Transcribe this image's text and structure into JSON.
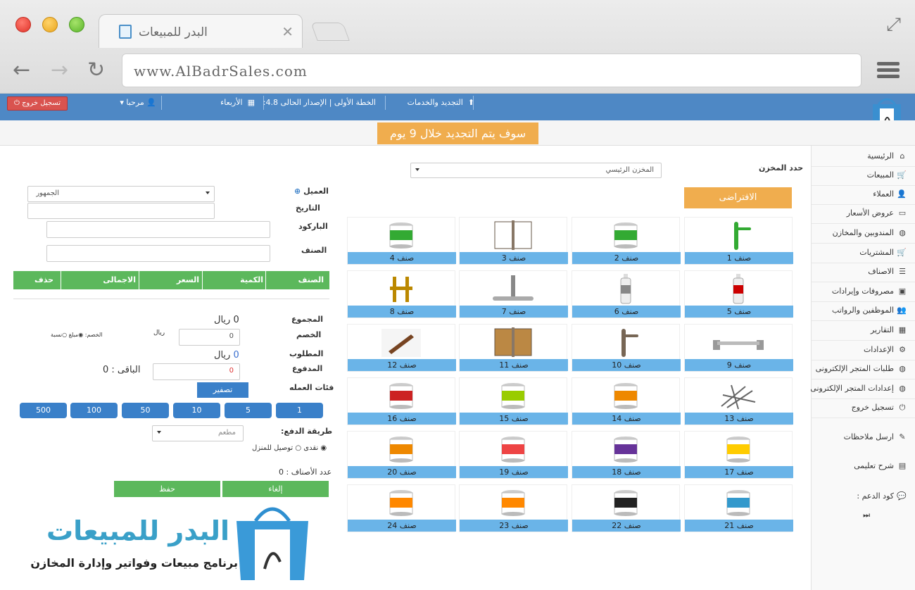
{
  "browser": {
    "tab_title": "البدر للمبيعات",
    "url": "www.AlBadrSales.com"
  },
  "topbar": {
    "updates": "التجديد والخدمات",
    "plan": "الخطة الأولى | الإصدار الحالى 4.8:",
    "day": "الأربعاء",
    "welcome": "مرحبا",
    "logout": "تسجيل خروج"
  },
  "notice": "سوف يتم التجديد خلال 9 يوم",
  "sidebar": {
    "items": [
      {
        "label": "الرئيسية",
        "icon": "home-icon"
      },
      {
        "label": "المبيعات",
        "icon": "cart-icon"
      },
      {
        "label": "العملاء",
        "icon": "user-icon"
      },
      {
        "label": "عروض الأسعار",
        "icon": "card-icon"
      },
      {
        "label": "المندوبين والمخازن",
        "icon": "globe-icon"
      },
      {
        "label": "المشتريات",
        "icon": "cart-plus-icon"
      },
      {
        "label": "الاصناف",
        "icon": "list-icon"
      },
      {
        "label": "مصروفات وإيرادات",
        "icon": "money-icon"
      },
      {
        "label": "الموظفين والرواتب",
        "icon": "users-icon"
      },
      {
        "label": "التقارير",
        "icon": "chart-icon"
      },
      {
        "label": "الإعدادات",
        "icon": "cogs-icon"
      },
      {
        "label": "طلبات المتجر الإلكترونى",
        "icon": "globe-icon"
      },
      {
        "label": "إعدادات المتجر الإلكترونى",
        "icon": "globe-icon"
      },
      {
        "label": "تسجيل خروج",
        "icon": "power-icon"
      },
      {
        "label": "ارسل ملاحظات",
        "icon": "pencil-icon"
      },
      {
        "label": "شرح تعليمى",
        "icon": "book-icon"
      },
      {
        "label": "كود الدعم :",
        "icon": "comments-icon"
      }
    ]
  },
  "warehouse": {
    "label": "حدد المخزن",
    "value": "المخزن الرئيسي",
    "default_button": "الافتراضى"
  },
  "products": [
    "صنف 1",
    "صنف 2",
    "صنف 3",
    "صنف 4",
    "صنف 5",
    "صنف 6",
    "صنف 7",
    "صنف 8",
    "صنف 9",
    "صنف 10",
    "صنف 11",
    "صنف 12",
    "صنف 13",
    "صنف 14",
    "صنف 15",
    "صنف 16",
    "صنف 17",
    "صنف 18",
    "صنف 19",
    "صنف 20",
    "صنف 21",
    "صنف 22",
    "صنف 23",
    "صنف 24"
  ],
  "form": {
    "customer_label": "العميل",
    "customer_value": "الجمهور",
    "date_label": "التاريخ",
    "barcode_label": "الباركود",
    "item_label": "الصنف",
    "table_headers": [
      "الصنف",
      "الكمية",
      "السعر",
      "الاجمالى",
      "حذف"
    ],
    "total_label": "المجموع",
    "total_value": "0",
    "currency": "ريال",
    "discount_label": "الخصم",
    "discount_value": "0",
    "discount_type_label": "الخصم:",
    "discount_opt1": "مبلغ",
    "discount_opt2": "نسبة",
    "required_label": "المطلوب",
    "required_value": "0",
    "paid_label": "المدفوع",
    "paid_value": "0",
    "remaining": "الباقى : 0",
    "denominations_label": "فئات العمله",
    "reset_button": "تصفير",
    "denominations": [
      "1",
      "5",
      "10",
      "50",
      "100",
      "500"
    ],
    "payment_label": "طريقة الدفع:",
    "payment_value": "مطعم",
    "order_type_opt1": "نقدى",
    "order_type_opt2": "توصيل للمنزل",
    "items_count": "عدد الأصناف : 0",
    "cancel_button": "إلغاء",
    "save_button": "حفظ"
  },
  "brand": {
    "title": "البدر للمبيعات",
    "subtitle": "برنامج مبيعات وفواتير وإدارة المخازن"
  },
  "colors": {
    "topbar": "#4e88c5",
    "green": "#5cb85c",
    "orange": "#f0ad4e",
    "blue": "#3a80c9",
    "red": "#d9534f",
    "tile": "#6ab4e8"
  }
}
